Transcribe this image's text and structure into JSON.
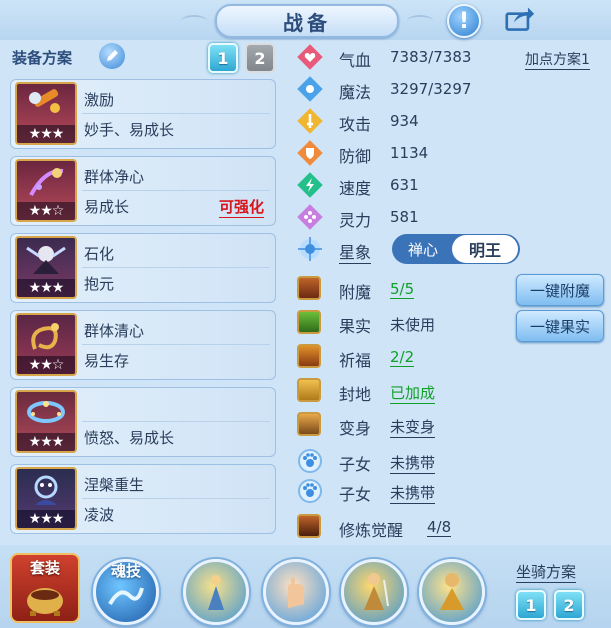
{
  "window": {
    "title": "战备"
  },
  "left_panel": {
    "scheme_label": "装备方案",
    "scheme_buttons": [
      "1",
      "2"
    ],
    "equipment": [
      {
        "name": "激励",
        "sub": "妙手、易成长",
        "stars": "★★★",
        "tag": ""
      },
      {
        "name": "群体净心",
        "sub": "易成长",
        "stars": "★★☆",
        "tag": "可强化"
      },
      {
        "name": "石化",
        "sub": "抱元",
        "stars": "★★★",
        "tag": ""
      },
      {
        "name": "群体清心",
        "sub": "易生存",
        "stars": "★★☆",
        "tag": ""
      },
      {
        "name": "",
        "sub": "愤怒、易成长",
        "stars": "★★★",
        "tag": ""
      },
      {
        "name": "涅槃重生",
        "sub": "凌波",
        "stars": "★★★",
        "tag": ""
      }
    ]
  },
  "stats": {
    "add_point_label": "加点方案1",
    "rows": [
      {
        "name": "气血",
        "value": "7383/7383",
        "icon": "heart-icon",
        "color": "#e85a7a"
      },
      {
        "name": "魔法",
        "value": "3297/3297",
        "icon": "mana-icon",
        "color": "#4aa3ea"
      },
      {
        "name": "攻击",
        "value": "934",
        "icon": "attack-icon",
        "color": "#f0b531"
      },
      {
        "name": "防御",
        "value": "1134",
        "icon": "defense-icon",
        "color": "#f08a3c"
      },
      {
        "name": "速度",
        "value": "631",
        "icon": "speed-icon",
        "color": "#23c08a"
      },
      {
        "name": "灵力",
        "value": "581",
        "icon": "spirit-icon",
        "color": "#c77ee0"
      }
    ]
  },
  "star_sign": {
    "label": "星象",
    "options": [
      "禅心",
      "明王"
    ],
    "selected": "明王"
  },
  "enhance": [
    {
      "name": "附魔",
      "value": "5/5"
    },
    {
      "name": "果实",
      "value": "未使用"
    },
    {
      "name": "祈福",
      "value": "2/2"
    },
    {
      "name": "封地",
      "value": "已加成"
    },
    {
      "name": "变身",
      "value": "未变身"
    },
    {
      "name": "子女",
      "value": "未携带"
    },
    {
      "name": "子女",
      "value": "未携带"
    },
    {
      "name": "修炼觉醒",
      "value": "4/8"
    }
  ],
  "actions": {
    "enchant": "一键附魔",
    "fruit": "一键果实"
  },
  "bottom": {
    "suit_label": "套装",
    "soul_label": "魂技",
    "mount_label": "坐骑方案",
    "mount_buttons": [
      "1",
      "2"
    ]
  },
  "colors": {
    "accent": "#2ea7d3",
    "red_tag": "#d8141b",
    "green_value": "#10a028"
  }
}
